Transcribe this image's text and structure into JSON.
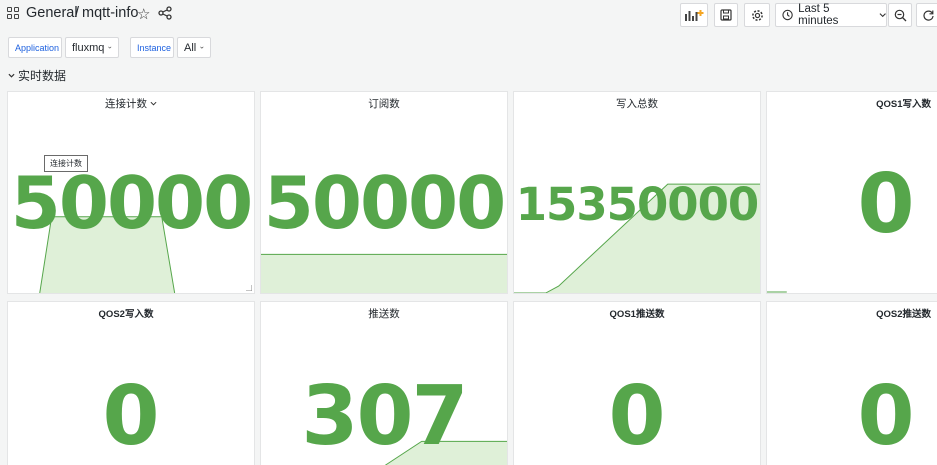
{
  "header": {
    "folder": "General",
    "separator": "/",
    "dashboard_title": "mqtt-info",
    "time_range_label": "Last 5 minutes"
  },
  "icons": {
    "apps": "grid-icon",
    "favorite": "star-icon",
    "share": "share-icon",
    "add_panel": "bar-chart-add-icon",
    "save": "save-icon",
    "settings": "gear-icon",
    "time": "clock-icon",
    "zoom_out": "zoom-out-icon",
    "refresh": "refresh-icon"
  },
  "variables": [
    {
      "label": "Application",
      "value": "fluxmq"
    },
    {
      "label": "Instance",
      "value": "All"
    }
  ],
  "row": {
    "title": "实时数据"
  },
  "colors": {
    "stat_green": "#56a64b",
    "spark_fill": "#dff0d8",
    "link_blue": "#1f62e0"
  },
  "panels": [
    {
      "title": "连接计数",
      "value": "50000",
      "tooltip": "连接计数"
    },
    {
      "title": "订阅数",
      "value": "50000"
    },
    {
      "title": "写入总数",
      "value": "15350000"
    },
    {
      "title": "QOS1写入数",
      "value": "0"
    },
    {
      "title": "QOS2写入数",
      "value": "0"
    },
    {
      "title": "推送数",
      "value": "307"
    },
    {
      "title": "QOS1推送数",
      "value": "0"
    },
    {
      "title": "QOS2推送数",
      "value": "0"
    }
  ]
}
